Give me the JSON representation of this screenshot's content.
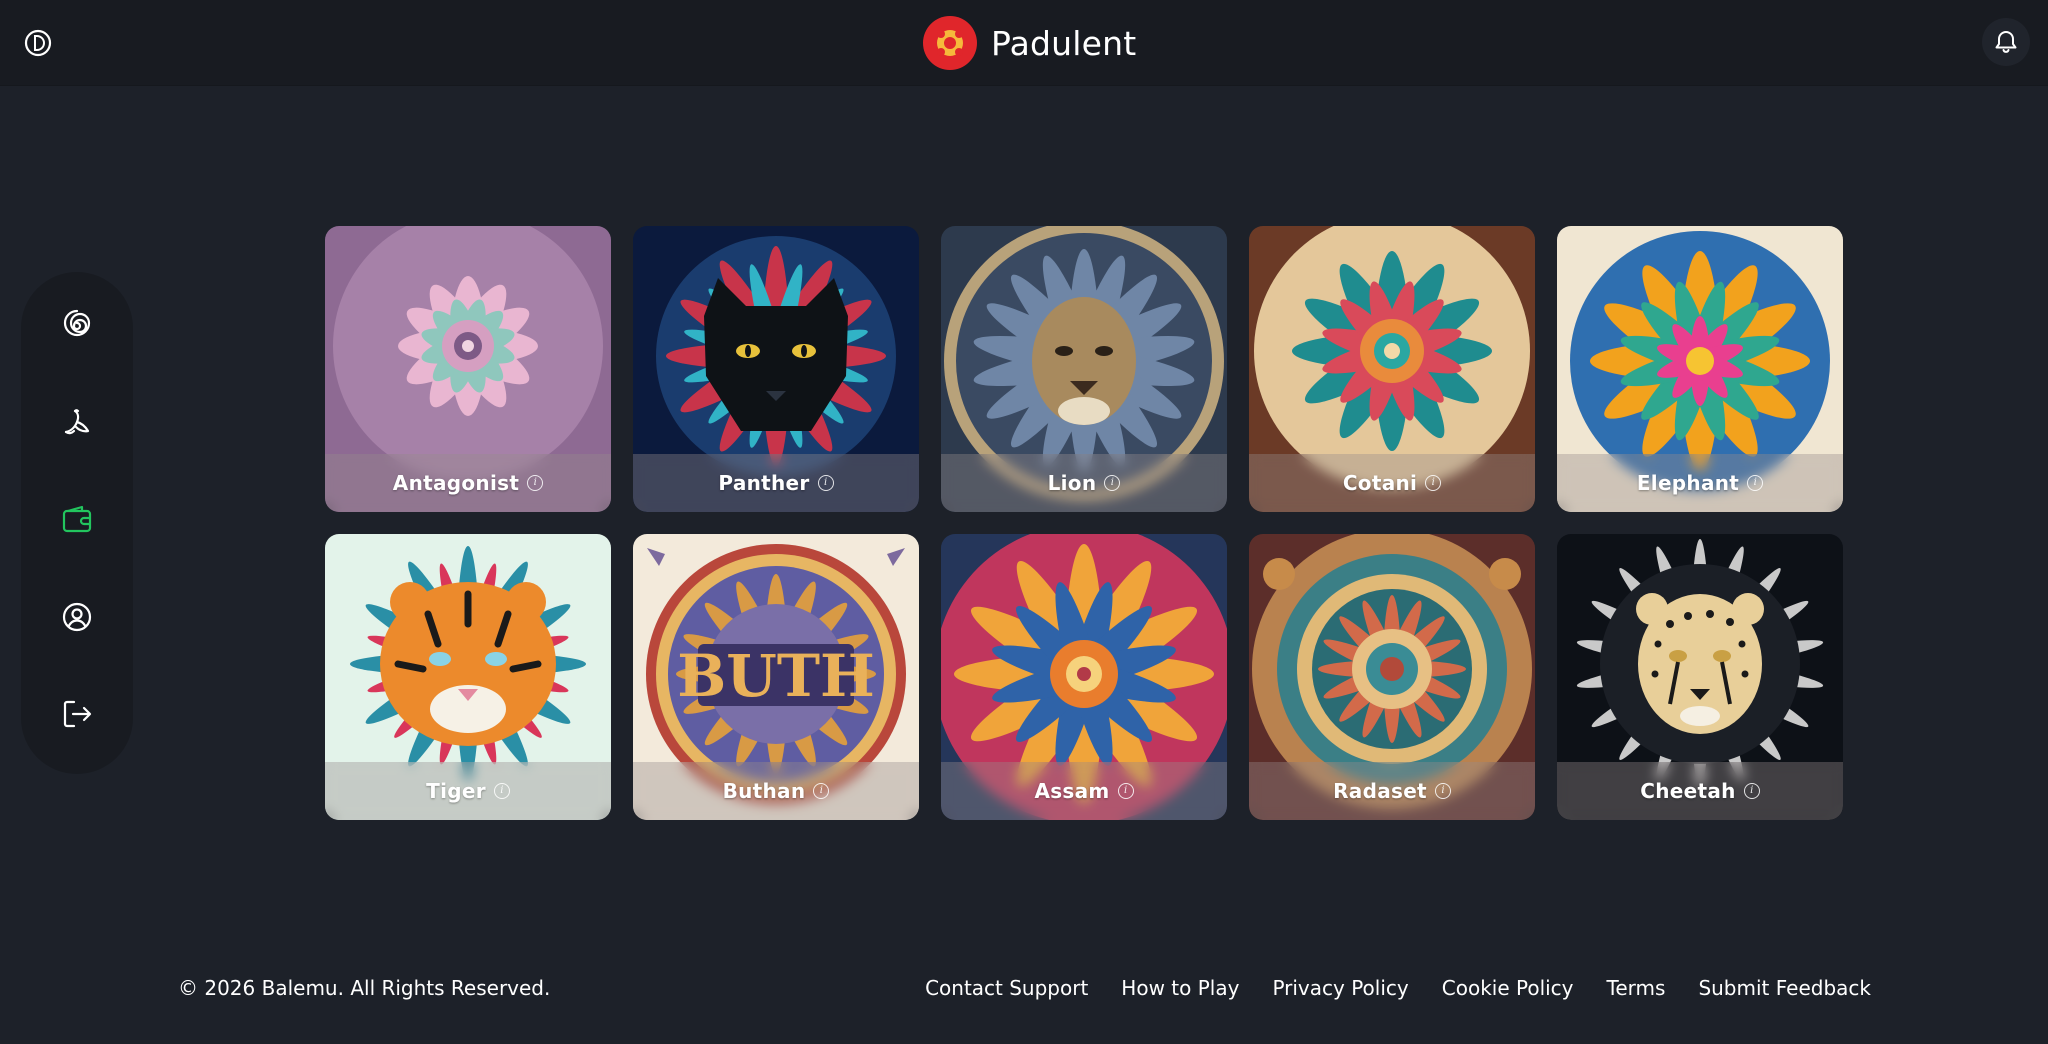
{
  "header": {
    "brand_name": "Padulent",
    "theme_toggle_icon": "contrast-toggle-icon",
    "notifications_icon": "bell-icon",
    "brand_color": "#e0262b"
  },
  "sidebar": {
    "items": [
      {
        "icon": "spiral-icon",
        "active": false
      },
      {
        "icon": "banana-icon",
        "active": false
      },
      {
        "icon": "wallet-icon",
        "active": true
      },
      {
        "icon": "user-circle-icon",
        "active": false
      },
      {
        "icon": "logout-icon",
        "active": false
      }
    ],
    "active_color": "#22c55e"
  },
  "cards": [
    {
      "name": "Antagonist"
    },
    {
      "name": "Panther"
    },
    {
      "name": "Lion"
    },
    {
      "name": "Cotani"
    },
    {
      "name": "Elephant"
    },
    {
      "name": "Tiger"
    },
    {
      "name": "Buthan"
    },
    {
      "name": "Assam"
    },
    {
      "name": "Radaset"
    },
    {
      "name": "Cheetah"
    }
  ],
  "footer": {
    "copyright": "© 2026 Balemu. All Rights Reserved.",
    "links": [
      "Contact Support",
      "How to Play",
      "Privacy Policy",
      "Cookie Policy",
      "Terms",
      "Submit Feedback"
    ]
  }
}
